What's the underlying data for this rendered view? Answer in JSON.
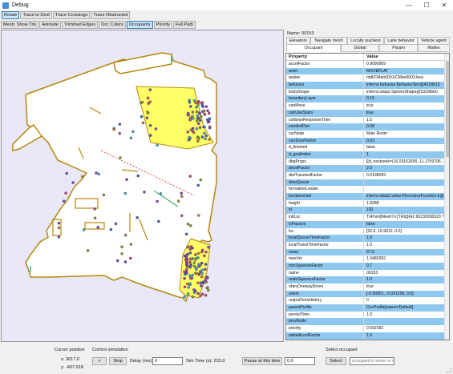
{
  "window": {
    "title": "Debug",
    "minimize": "—",
    "maximize": "☐",
    "close": "✕"
  },
  "toolbar1": [
    "Rotate",
    "Trace to Dest",
    "Trace Crossings",
    "Trace Obstructed"
  ],
  "toolbar2": [
    "Mesh: Show Tris",
    "Animate",
    "Trimmed Edges",
    "Occ Colors",
    "Occupants",
    "Priority",
    "Full Path"
  ],
  "name_row": "Name: 00153",
  "tabs_top": [
    "Elevators",
    "Navigate mesh",
    "Locally quickest",
    "Lane behavior",
    "Vehicle agent"
  ],
  "tabs_bottom": [
    "Occupant",
    "Global",
    "Param",
    "Nodes"
  ],
  "table": {
    "headers": [
      "Property",
      "Value"
    ],
    "rows": [
      [
        "accelFactor",
        "0.9090909"
      ],
      [
        "anim",
        "MOVEFLAT"
      ],
      [
        "avatar",
        "mdl/CMan0001/CMan0003.bea"
      ],
      [
        "behavior",
        "inferno.behavior.BehaviorSim@4218b13"
      ],
      [
        "bodyShape",
        "inferno.data2.SphereShape@5329tb60"
      ],
      [
        "boundaryLayer",
        "0.15"
      ],
      [
        "canMove",
        "true"
      ],
      [
        "canUseStairs",
        "true"
      ],
      [
        "collisionResponseTime",
        "1.5"
      ],
      [
        "comfortDist",
        "0.08"
      ],
      [
        "curNode",
        "Main Room"
      ],
      [
        "currDoorFactor",
        "0.63"
      ],
      [
        "d_finished",
        "false"
      ],
      [
        "d_goalIndex",
        "1"
      ],
      [
        "dbgProps",
        "[[d_nextseek=(16.03162656, 11.1709796..."
      ],
      [
        "decelFactor",
        "2.0"
      ],
      [
        "distTraveledFactor",
        "0.0198043"
      ],
      [
        "doorQueue",
        ""
      ],
      [
        "formationLeader",
        ""
      ],
      [
        "fundamental",
        "inferno.data2.value.PiecewiseFunction.b@..."
      ],
      [
        "height",
        "1.8288"
      ],
      [
        "id",
        "152"
      ],
      [
        "initLoc",
        "TriPoint[Mesh?n:[TRI@[42.60230936520 78..."
      ],
      [
        "isPassive",
        "false"
      ],
      [
        "loc",
        "[32.6, 16.9612, 0.0]"
      ],
      [
        "localQueueTimeFactor",
        "1.0"
      ],
      [
        "localTravelTimeFactor",
        "1.0"
      ],
      [
        "mass",
        "67.5"
      ],
      [
        "maxVel",
        "1.3480392"
      ],
      [
        "minSqueezeFactor",
        "0.7"
      ],
      [
        "name",
        "00153"
      ],
      [
        "nodeSqueezeFactor",
        "1.0"
      ],
      [
        "obeyOnewayDoors",
        "true"
      ],
      [
        "orient",
        "[-0.99951, -0.031299, 0.0]"
      ],
      [
        "outputTimeHistory",
        "0"
      ],
      [
        "parentProfile",
        "OccProfile[name=Default]"
      ],
      [
        "persistTime",
        "1.0"
      ],
      [
        "prevNode",
        ""
      ],
      [
        "priority",
        "0.592392"
      ],
      [
        "radialAccelFactor",
        "1.5"
      ]
    ]
  },
  "bottom": {
    "cursor_position_label": "Cursor position",
    "cursor_x": "x: 3617.0",
    "cursor_y": "y: -407.918",
    "control_sim_label": "Control simulation",
    "play_button": ">",
    "step_button": "Step",
    "delay_label": "Delay (ms):",
    "delay_value": "0",
    "sim_time_label": "Sim Time (s): 233.0",
    "pause_button": "Pause at this time",
    "pause_value": "0.0",
    "select_occupant_label": "Select occupant",
    "select_button": "Select",
    "occupant_placeholder": "occupant's name or id"
  },
  "colors": {
    "floor": "#ffffff",
    "background": "#e8e8f8",
    "wall": "#b8860b",
    "yellow_zone": "#ffff66",
    "row_highlight": "#8ec7ef",
    "trace_red": "#e02020",
    "trace_green": "#20a040"
  }
}
